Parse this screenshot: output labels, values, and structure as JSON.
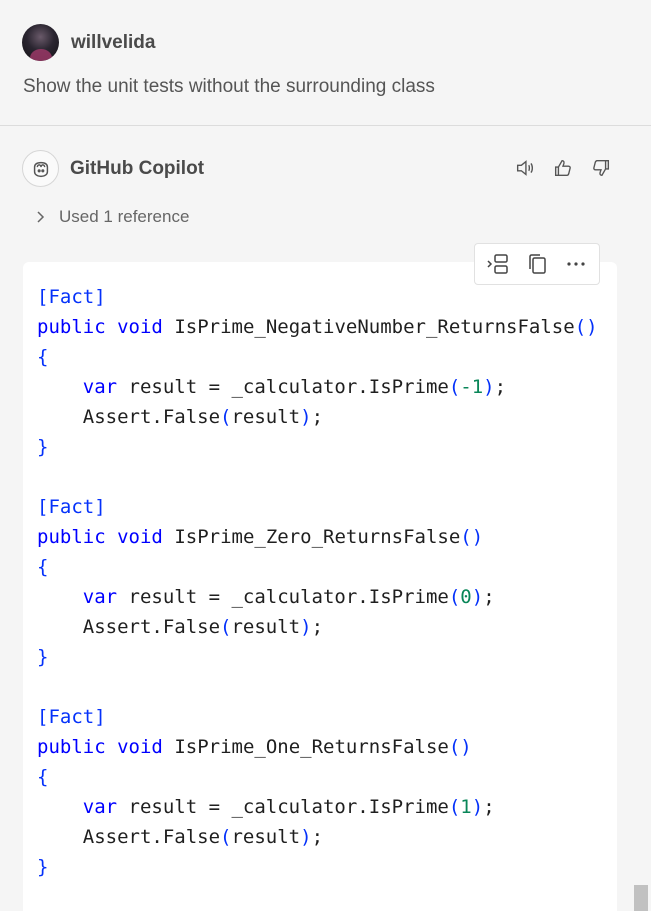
{
  "user": {
    "name": "willvelida",
    "message": "Show the unit tests without the surrounding class"
  },
  "assistant": {
    "name": "GitHub Copilot",
    "actions": [
      {
        "icon": "speaker-icon",
        "label": "Read aloud"
      },
      {
        "icon": "thumbs-up-icon",
        "label": "Helpful"
      },
      {
        "icon": "thumbs-down-icon",
        "label": "Not helpful"
      }
    ],
    "references_label": "Used 1 reference"
  },
  "code_block": {
    "toolbar": [
      {
        "icon": "insert-code-icon"
      },
      {
        "icon": "copy-icon"
      },
      {
        "icon": "more-icon"
      }
    ],
    "tests": [
      {
        "attribute": "[Fact]",
        "method": "IsPrime_NegativeNumber_ReturnsFalse",
        "arg": "-1"
      },
      {
        "attribute": "[Fact]",
        "method": "IsPrime_Zero_ReturnsFalse",
        "arg": "0"
      },
      {
        "attribute": "[Fact]",
        "method": "IsPrime_One_ReturnsFalse",
        "arg": "1"
      }
    ]
  },
  "colors": {
    "keyword": "#0000ff",
    "number": "#098658",
    "punctuation": "#0431fa",
    "background": "#f5f5f5"
  }
}
